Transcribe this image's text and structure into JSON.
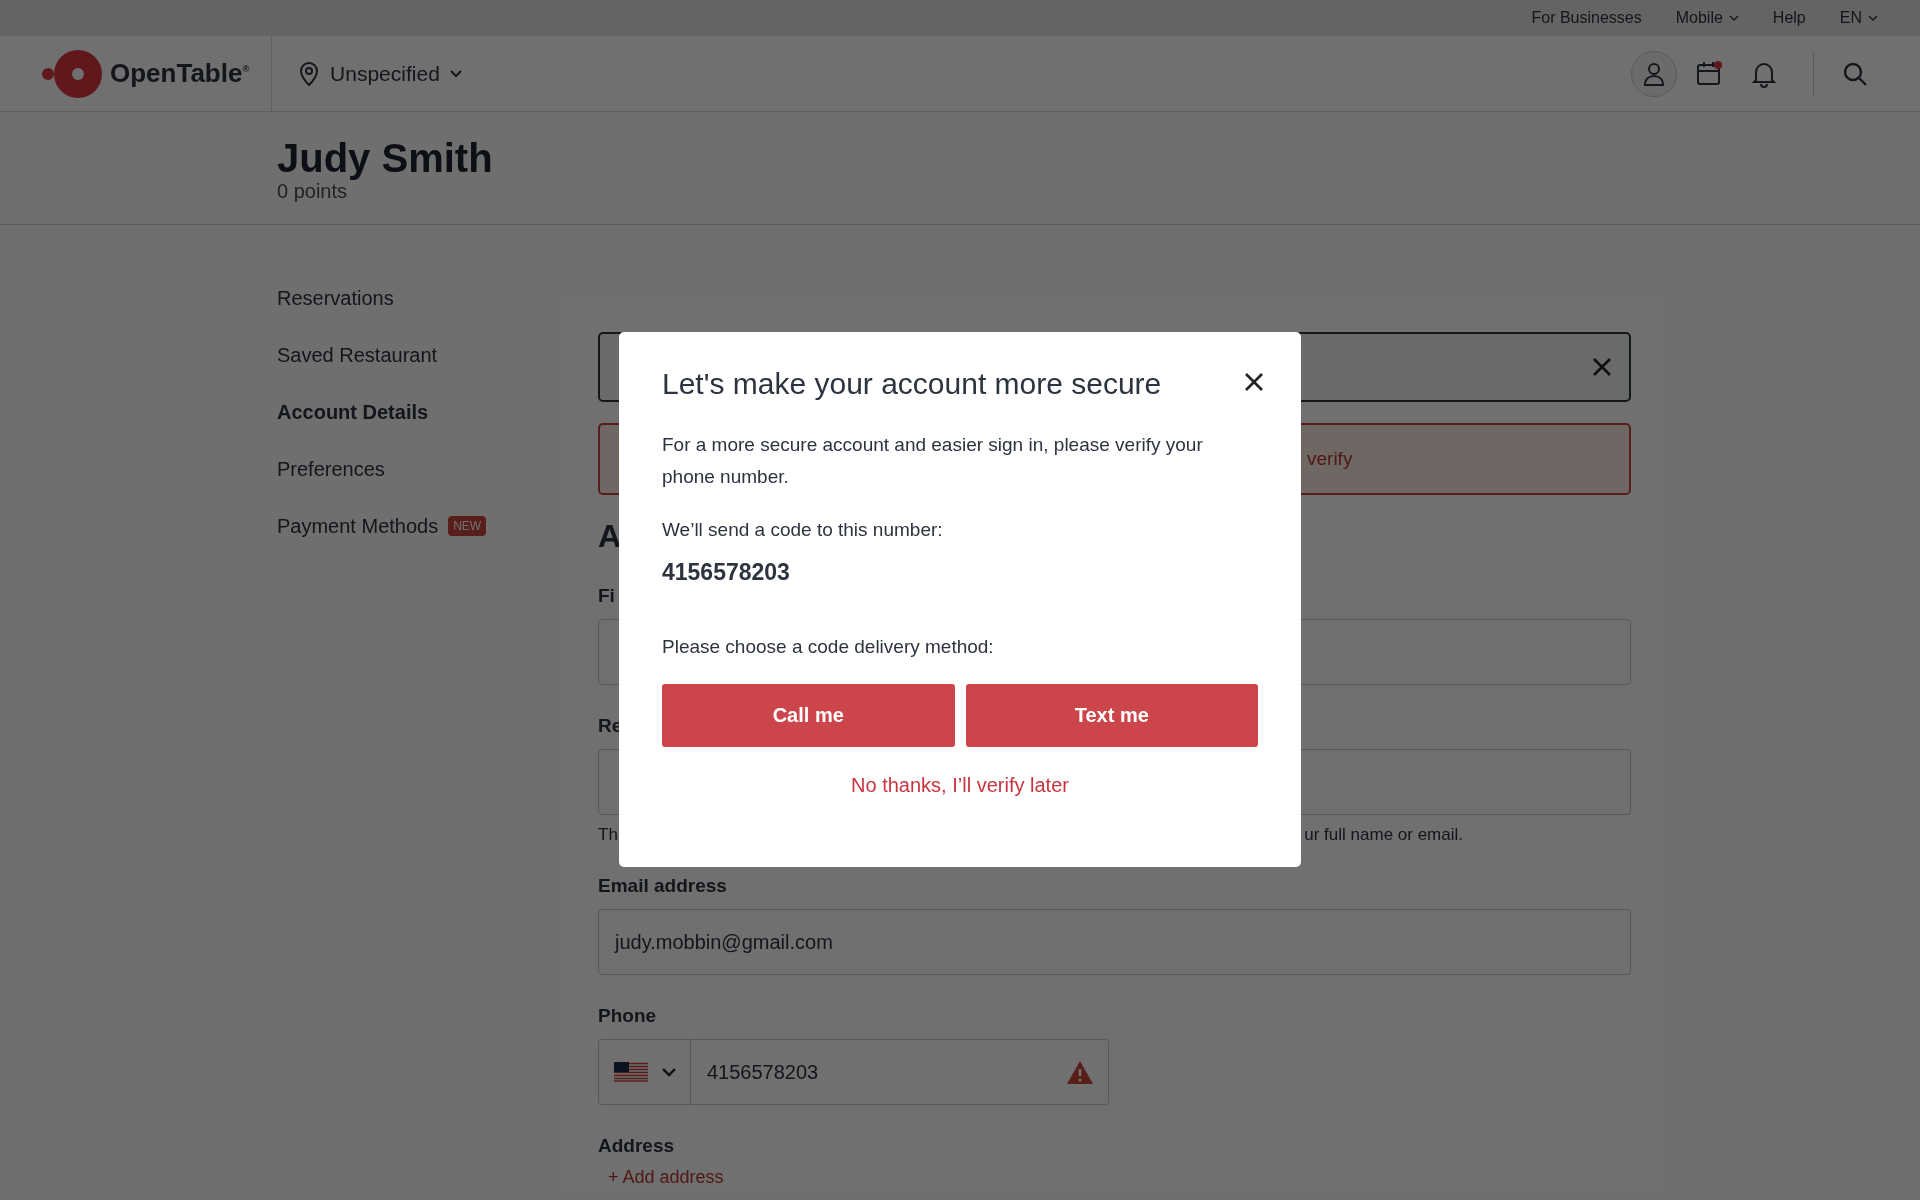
{
  "top_links": [
    {
      "label": "For Businesses",
      "dropdown": false
    },
    {
      "label": "Mobile",
      "dropdown": true
    },
    {
      "label": "Help",
      "dropdown": false
    },
    {
      "label": "EN",
      "dropdown": true
    }
  ],
  "header": {
    "logo": "OpenTable$^{®}$",
    "location": "Unspecified"
  },
  "profile": {
    "name": "Judy Smith",
    "points": "0 points"
  },
  "sidebar": {
    "items": [
      {
        "label": "Reservations",
        "selected": false
      },
      {
        "label": "Saved Restaurant",
        "selected": false
      },
      {
        "label": "Account Details",
        "selected": true
      },
      {
        "label": "Preferences",
        "selected": false
      },
      {
        "label": "Payment Methods",
        "selected": false,
        "badge": "NEW"
      }
    ]
  },
  "form": {
    "alert_text": "verify",
    "heading": "A",
    "fields": [
      {
        "label": "Fi"
      },
      {
        "label": "Re",
        "hint_start": "Th",
        "hint_end": "ur full name or email."
      },
      {
        "label": "Email address",
        "value": "judy.mobbin@gmail.com"
      }
    ],
    "phone": {
      "label": "Phone",
      "value": "4156578203",
      "warning": true
    },
    "address": {
      "label": "Address",
      "link": "+ Add address"
    }
  },
  "modal": {
    "title": "Let's make your account more secure",
    "body": "For a more secure account and easier sign in, please verify your phone number.",
    "send_note": "We’ll send a code to this number:",
    "number": "4156578203",
    "method_prompt": "Please choose a code delivery method:",
    "buttons": [
      "Call me",
      "Text me"
    ],
    "later_link": "No thanks, I’ll verify later"
  }
}
